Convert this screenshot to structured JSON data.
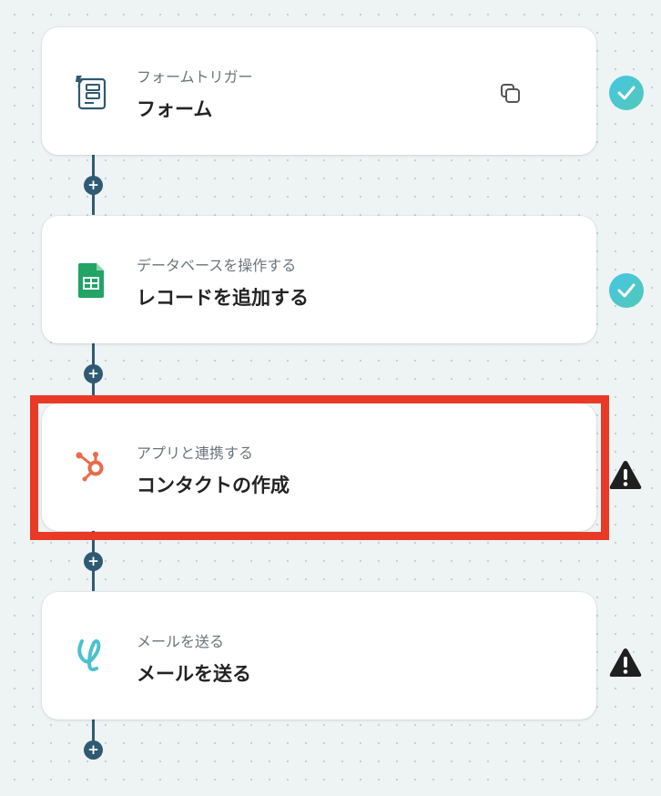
{
  "steps": [
    {
      "category": "フォームトリガー",
      "title": "フォーム",
      "icon": "form-trigger-icon",
      "status": "completed",
      "has_copy_button": true
    },
    {
      "category": "データベースを操作する",
      "title": "レコードを追加する",
      "icon": "google-sheets-icon",
      "status": "completed"
    },
    {
      "category": "アプリと連携する",
      "title": "コンタクトの作成",
      "icon": "hubspot-icon",
      "status": "warning",
      "highlighted": true
    },
    {
      "category": "メールを送る",
      "title": "メールを送る",
      "icon": "mail-icon",
      "status": "warning"
    }
  ],
  "add_step_symbol": "+",
  "colors": {
    "connector": "#2f5a73",
    "highlight_border": "#e83a27",
    "check_badge": "#4bc5d6",
    "warning_badge": "#1f1f1f",
    "sheets_green": "#21a464",
    "hubspot_orange": "#ea6a4a",
    "mail_teal": "#4bc1cf"
  }
}
